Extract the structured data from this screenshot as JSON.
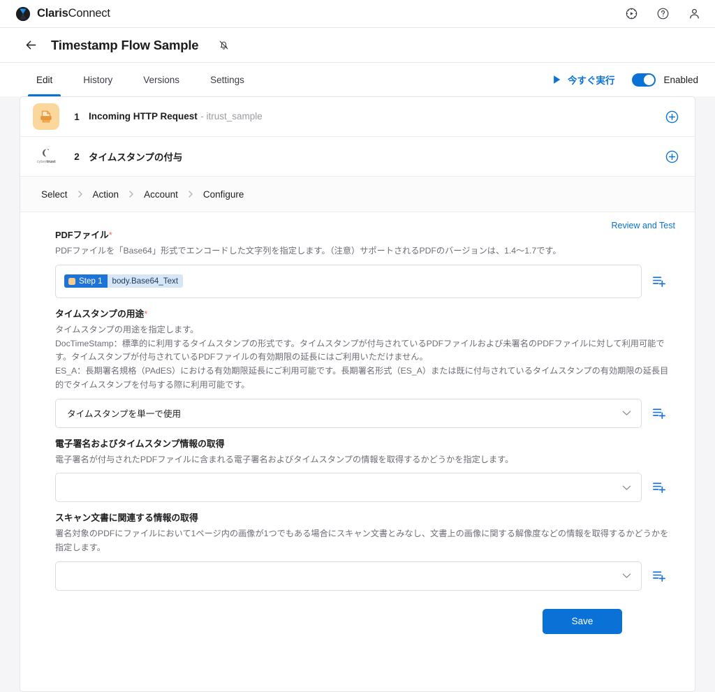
{
  "appbar": {
    "brand_bold": "Claris",
    "brand_light": "Connect",
    "icons": [
      {
        "name": "automation-gear-icon"
      },
      {
        "name": "help-question-icon"
      },
      {
        "name": "user-account-icon"
      }
    ]
  },
  "titlebar": {
    "back_icon": "back-arrow-icon",
    "title": "Timestamp Flow Sample",
    "bell_icon": "bell-muted-icon"
  },
  "tabs": [
    {
      "label": "Edit",
      "active": true
    },
    {
      "label": "History",
      "active": false
    },
    {
      "label": "Versions",
      "active": false
    },
    {
      "label": "Settings",
      "active": false
    }
  ],
  "run": {
    "play_icon": "play-triangle-icon",
    "run_label": "今すぐ実行",
    "toggle_on": true,
    "enabled_label": "Enabled"
  },
  "steps": [
    {
      "number": "1",
      "icon": "http-request-icon",
      "name": "Incoming HTTP Request",
      "sub": "- itrust_sample",
      "add_icon": "plus-circle-icon"
    },
    {
      "number": "2",
      "icon": "cybertrust-logo-icon",
      "name": "タイムスタンプの付与",
      "sub": "",
      "add_icon": "plus-circle-icon"
    }
  ],
  "breadcrumb": [
    "Select",
    "Action",
    "Account",
    "Configure"
  ],
  "form": {
    "review_link": "Review and Test",
    "fields": [
      {
        "label": "PDFファイル",
        "required": true,
        "desc": "PDFファイルを「Base64」形式でエンコードした文字列を指定します。（注意）サポートされるPDFのバージョンは、1.4〜1.7です。",
        "control": "token",
        "token_step": "Step 1",
        "token_value": "body.Base64_Text",
        "insert_icon": "insert-field-icon"
      },
      {
        "label": "タイムスタンプの用途",
        "required": true,
        "desc": "タイムスタンプの用途を指定します。\nDocTimeStamp：標準的に利用するタイムスタンプの形式です。タイムスタンプが付与されているPDFファイルおよび未署名のPDFファイルに対して利用可能です。タイムスタンプが付与されているPDFファイルの有効期限の延長にはご利用いただけません。\nES_A：長期署名規格（PAdES）における有効期限延長にご利用可能です。長期署名形式（ES_A）または既に付与されているタイムスタンプの有効期限の延長目的でタイムスタンプを付与する際に利用可能です。",
        "control": "select",
        "value": "タイムスタンプを単一で使用",
        "chevron_icon": "chevron-down-icon",
        "insert_icon": "insert-field-icon"
      },
      {
        "label": "電子署名およびタイムスタンプ情報の取得",
        "required": false,
        "desc": "電子署名が付与されたPDFファイルに含まれる電子署名およびタイムスタンプの情報を取得するかどうかを指定します。",
        "control": "select",
        "value": "",
        "chevron_icon": "chevron-down-icon",
        "insert_icon": "insert-field-icon"
      },
      {
        "label": "スキャン文書に関連する情報の取得",
        "required": false,
        "desc": "署名対象のPDFにファイルにおいて1ページ内の画像が1つでもある場合にスキャン文書とみなし、文書上の画像に関する解像度などの情報を取得するかどうかを指定します。",
        "control": "select",
        "value": "",
        "chevron_icon": "chevron-down-icon",
        "insert_icon": "insert-field-icon"
      }
    ],
    "save_label": "Save"
  },
  "colors": {
    "accent_blue": "#0a72d6",
    "required_red": "#f0675a",
    "step_icon_orange": "#fcd79b",
    "page_bg": "#f5f5f7"
  }
}
